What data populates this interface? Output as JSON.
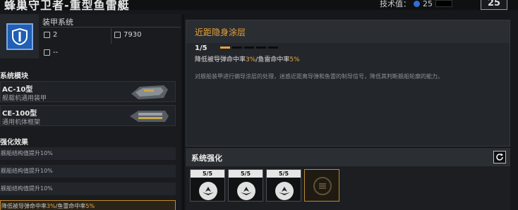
{
  "header": {
    "title": "蜂巢守卫者-重型鱼雷艇",
    "tech_label": "技术值：",
    "tech_value": "25",
    "corner_value": "25"
  },
  "armor": {
    "title": "装甲系统",
    "stat1": "2",
    "stat2": "7930",
    "stat3": "--"
  },
  "modules": {
    "title": "系统模块",
    "items": [
      {
        "name": "AC-10型",
        "sub": "舰载机通用装甲"
      },
      {
        "name": "CE-100型",
        "sub": "通用机体框架"
      }
    ]
  },
  "buffs": {
    "title": "强化效果",
    "rows": [
      "舰船结构值提升10%",
      "舰船结构值提升10%",
      "舰船结构值提升10%"
    ],
    "active_pre": "降低被导弹命中率",
    "active_v1": "3%",
    "active_mid": "/鱼雷命中率",
    "active_v2": "5%"
  },
  "detail": {
    "title": "近距隐身涂层",
    "level": "1/5",
    "level_current": 1,
    "level_max": 5,
    "effect_pre": "降低被导弹命中率",
    "effect_v1": "3%",
    "effect_mid": "/鱼雷命中率",
    "effect_v2": "5%",
    "description": "对舰船装甲进行偏导涂层的处理，迷惑近距离导弹和鱼雷的制导信号，降低其判断舰船轮廓的能力。"
  },
  "enhance": {
    "title": "系统强化",
    "slots": [
      {
        "count": "5/5"
      },
      {
        "count": "5/5"
      },
      {
        "count": "5/5"
      }
    ]
  },
  "colors": {
    "accent": "#e9a43a",
    "armor_blue": "#1f5fb4"
  }
}
